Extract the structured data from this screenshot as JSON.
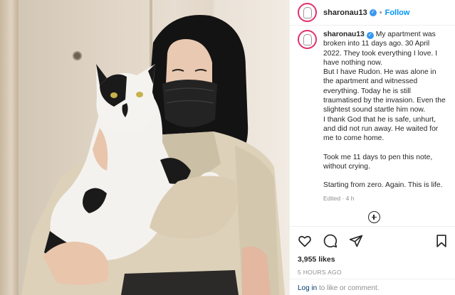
{
  "post": {
    "username": "sharonau13",
    "follow_label": "Follow",
    "dot": "•",
    "caption": {
      "username": "sharonau13",
      "lines": [
        "My apartment was broken into 11 days ago. 30 April 2022. They took everything I love. I have nothing now.",
        "But I have Rudon. He was alone in the apartment and witnessed everything. Today he is still traumatised by the invasion. Even the slightest sound startle him now.",
        "I thank God that he is safe, unhurt, and did not run away. He waited for me to come home.",
        "Took me 11 days to pen this note, without crying.",
        "Starting from zero. Again. This is life."
      ]
    },
    "edited": "Edited · 4 h",
    "likes": "3,955 likes",
    "time_ago": "5 HOURS AGO",
    "login_link": "Log in",
    "login_rest": " to like or comment."
  },
  "icons": [
    "verified-badge",
    "add-comment-icon",
    "heart-icon",
    "comment-icon",
    "share-icon",
    "bookmark-icon"
  ],
  "colors": {
    "link_blue": "#0095f6",
    "verified": "#3897f0",
    "login_link": "#00376b",
    "muted": "#8e8e8e"
  }
}
